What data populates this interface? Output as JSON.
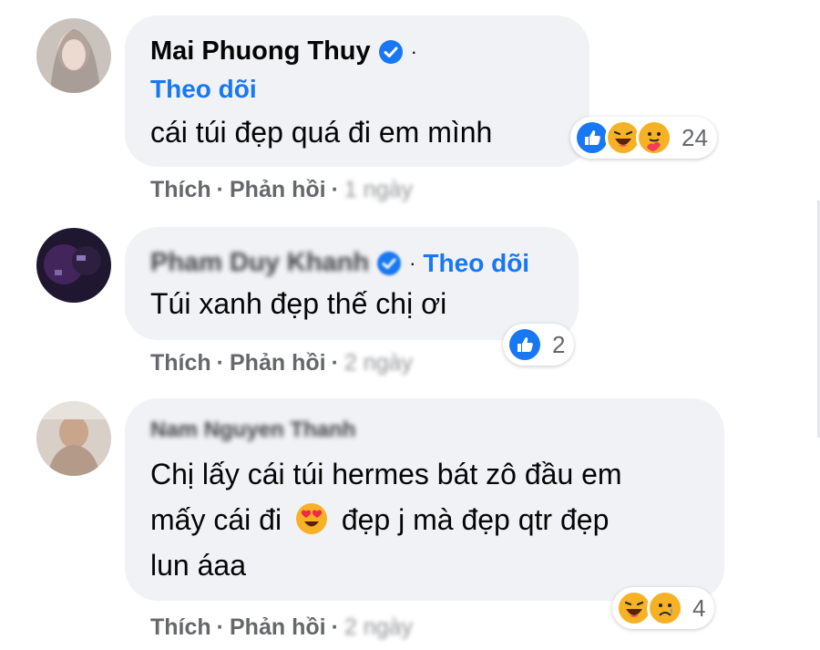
{
  "comments": [
    {
      "author": "Mai Phuong Thuy",
      "verified": true,
      "follow_label": "Theo dõi",
      "text": "cái túi đẹp quá đi em mình",
      "reaction_count": "24",
      "like_label": "Thích",
      "reply_label": "Phản hồi",
      "time": "1 ngày",
      "reactions": [
        "like-icon",
        "haha-icon",
        "care-icon"
      ]
    },
    {
      "author": "Pham Duy Khanh",
      "verified": true,
      "follow_label": "Theo dõi",
      "text": "Túi xanh đẹp thế chị ơi",
      "reaction_count": "2",
      "like_label": "Thích",
      "reply_label": "Phản hồi",
      "time": "2 ngày",
      "reactions": [
        "like-icon"
      ]
    },
    {
      "author": "Nam Nguyen Thanh",
      "verified": false,
      "text_line1": "Chị lấy cái túi hermes bát zô đầu em",
      "text_line2_a": "mấy cái đi",
      "text_line2_b": "đẹp j mà đẹp qtr đẹp",
      "text_line3": "lun áaa",
      "reaction_count": "4",
      "like_label": "Thích",
      "reply_label": "Phản hồi",
      "time": "2 ngày",
      "reactions": [
        "haha-icon",
        "sad-icon"
      ]
    }
  ],
  "separator": "·",
  "colors": {
    "link": "#1877f2",
    "bubble": "#f0f2f5",
    "meta": "#65676b"
  }
}
